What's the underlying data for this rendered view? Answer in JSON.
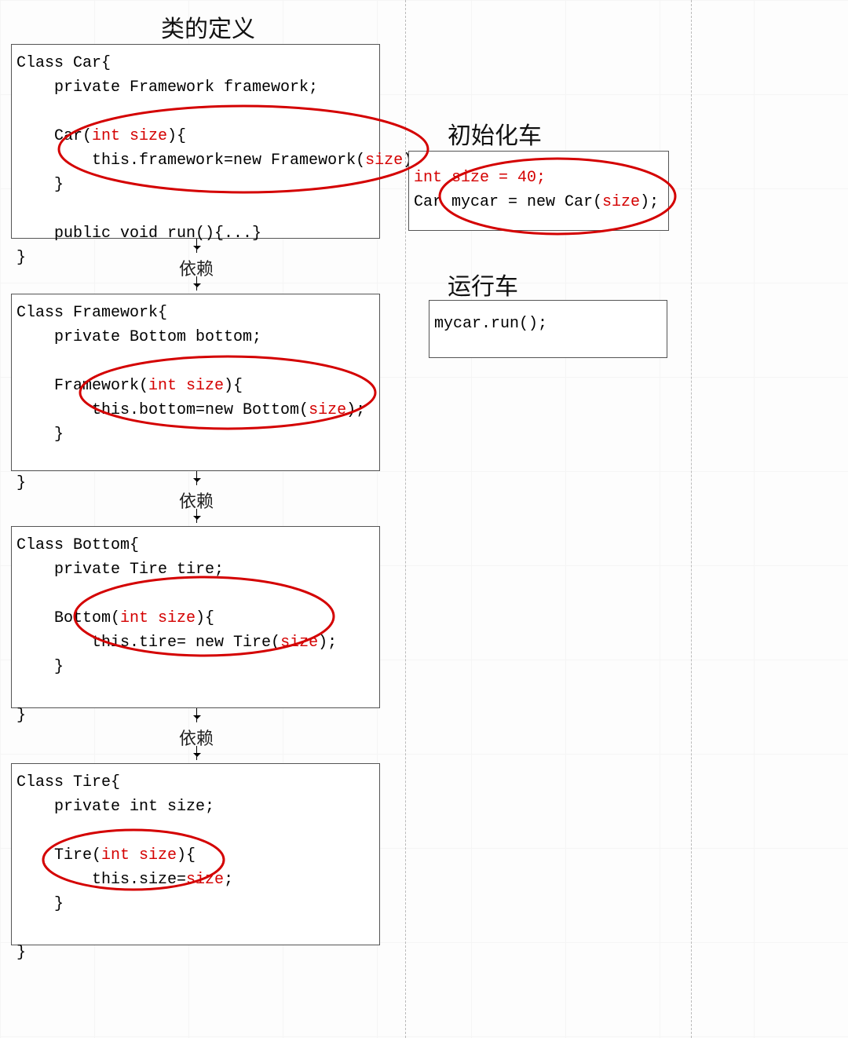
{
  "titles": {
    "class_def": "类的定义",
    "init_car": "初始化车",
    "run_car": "运行车"
  },
  "arrow_label": "依赖",
  "car": {
    "l1": "Class Car{",
    "l2": "    private Framework framework;",
    "l3": "",
    "l4a": "    Car(",
    "l4b": "int size",
    "l4c": "){",
    "l5a": "        this.framework=new Framework(",
    "l5b": "size",
    "l5c": ");",
    "l6": "    }",
    "l7": "",
    "l8": "    public void run(){...}",
    "l9": "}"
  },
  "framework": {
    "l1": "Class Framework{",
    "l2": "    private Bottom bottom;",
    "l3": "",
    "l4a": "    Framework(",
    "l4b": "int size",
    "l4c": "){",
    "l5a": "        this.bottom=new Bottom(",
    "l5b": "size",
    "l5c": ");",
    "l6": "    }",
    "l7": "",
    "l8": "}"
  },
  "bottom": {
    "l1": "Class Bottom{",
    "l2": "    private Tire tire;",
    "l3": "",
    "l4a": "    Bottom(",
    "l4b": "int size",
    "l4c": "){",
    "l5a": "        this.tire= new Tire(",
    "l5b": "size",
    "l5c": ");",
    "l6": "    }",
    "l7": "",
    "l8": "}"
  },
  "tire": {
    "l1": "Class Tire{",
    "l2": "    private int size;",
    "l3": "",
    "l4a": "    Tire(",
    "l4b": "int size",
    "l4c": "){",
    "l5a": "        this.size=",
    "l5b": "size",
    "l5c": ";",
    "l6": "    }",
    "l7": "",
    "l8": "}"
  },
  "init": {
    "l1": "int size = 40;",
    "l2a": "Car mycar = new Car(",
    "l2b": "size",
    "l2c": ");"
  },
  "run": {
    "l1": "mycar.run();"
  }
}
